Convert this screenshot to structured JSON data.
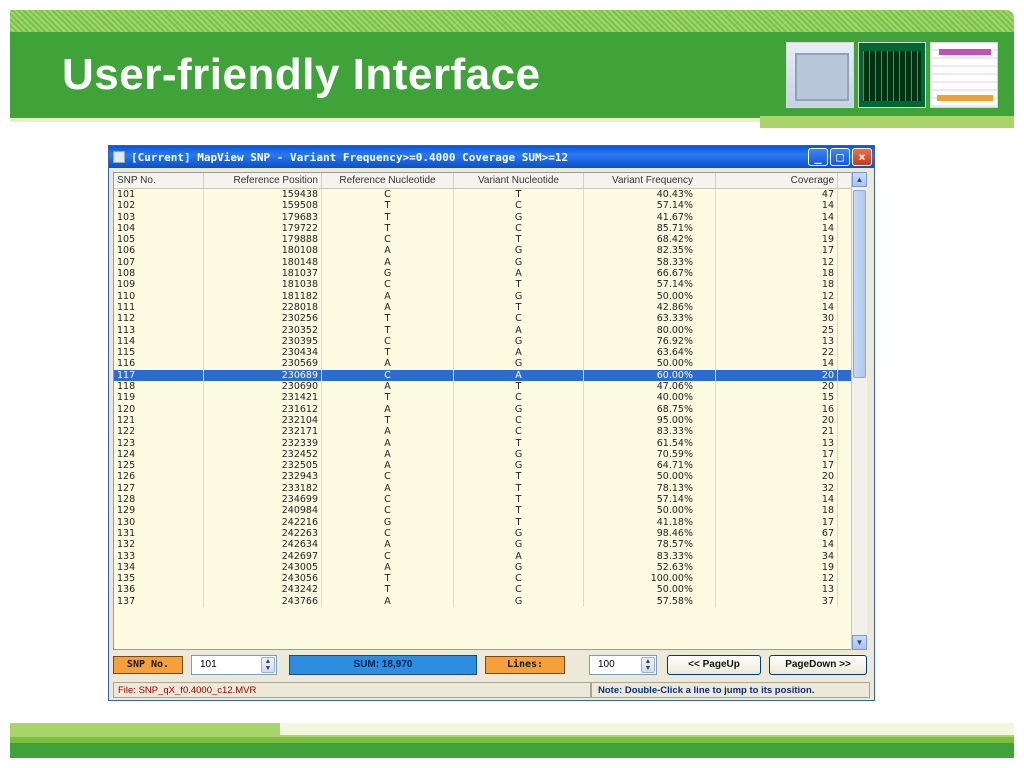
{
  "slide": {
    "title": "User-friendly Interface"
  },
  "window": {
    "title": "[Current] MapView SNP - Variant Frequency>=0.4000 Coverage SUM>=12",
    "controls": {
      "minimize": "_",
      "maximize": "□",
      "close": "×"
    }
  },
  "table": {
    "columns": [
      "SNP No.",
      "Reference Position",
      "Reference Nucleotide",
      "Variant Nucleotide",
      "Variant Frequency",
      "Coverage"
    ],
    "selected_row": "117",
    "rows": [
      [
        "101",
        "159438",
        "C",
        "T",
        "40.43%",
        "47"
      ],
      [
        "102",
        "159508",
        "T",
        "C",
        "57.14%",
        "14"
      ],
      [
        "103",
        "179683",
        "T",
        "G",
        "41.67%",
        "14"
      ],
      [
        "104",
        "179722",
        "T",
        "C",
        "85.71%",
        "14"
      ],
      [
        "105",
        "179888",
        "C",
        "T",
        "68.42%",
        "19"
      ],
      [
        "106",
        "180108",
        "A",
        "G",
        "82.35%",
        "17"
      ],
      [
        "107",
        "180148",
        "A",
        "G",
        "58.33%",
        "12"
      ],
      [
        "108",
        "181037",
        "G",
        "A",
        "66.67%",
        "18"
      ],
      [
        "109",
        "181038",
        "C",
        "T",
        "57.14%",
        "18"
      ],
      [
        "110",
        "181182",
        "A",
        "G",
        "50.00%",
        "12"
      ],
      [
        "111",
        "228018",
        "A",
        "T",
        "42.86%",
        "14"
      ],
      [
        "112",
        "230256",
        "T",
        "C",
        "63.33%",
        "30"
      ],
      [
        "113",
        "230352",
        "T",
        "A",
        "80.00%",
        "25"
      ],
      [
        "114",
        "230395",
        "C",
        "G",
        "76.92%",
        "13"
      ],
      [
        "115",
        "230434",
        "T",
        "A",
        "63.64%",
        "22"
      ],
      [
        "116",
        "230569",
        "A",
        "G",
        "50.00%",
        "14"
      ],
      [
        "117",
        "230689",
        "C",
        "A",
        "60.00%",
        "20"
      ],
      [
        "118",
        "230690",
        "A",
        "T",
        "47.06%",
        "20"
      ],
      [
        "119",
        "231421",
        "T",
        "C",
        "40.00%",
        "15"
      ],
      [
        "120",
        "231612",
        "A",
        "G",
        "68.75%",
        "16"
      ],
      [
        "121",
        "232104",
        "T",
        "C",
        "95.00%",
        "20"
      ],
      [
        "122",
        "232171",
        "A",
        "C",
        "83.33%",
        "21"
      ],
      [
        "123",
        "232339",
        "A",
        "T",
        "61.54%",
        "13"
      ],
      [
        "124",
        "232452",
        "A",
        "G",
        "70.59%",
        "17"
      ],
      [
        "125",
        "232505",
        "A",
        "G",
        "64.71%",
        "17"
      ],
      [
        "126",
        "232943",
        "C",
        "T",
        "50.00%",
        "20"
      ],
      [
        "127",
        "233182",
        "A",
        "T",
        "78.13%",
        "32"
      ],
      [
        "128",
        "234699",
        "C",
        "T",
        "57.14%",
        "14"
      ],
      [
        "129",
        "240984",
        "C",
        "T",
        "50.00%",
        "18"
      ],
      [
        "130",
        "242216",
        "G",
        "T",
        "41.18%",
        "17"
      ],
      [
        "131",
        "242263",
        "C",
        "G",
        "98.46%",
        "67"
      ],
      [
        "132",
        "242634",
        "A",
        "G",
        "78.57%",
        "14"
      ],
      [
        "133",
        "242697",
        "C",
        "A",
        "83.33%",
        "34"
      ],
      [
        "134",
        "243005",
        "A",
        "G",
        "52.63%",
        "19"
      ],
      [
        "135",
        "243056",
        "T",
        "C",
        "100.00%",
        "12"
      ],
      [
        "136",
        "243242",
        "T",
        "C",
        "50.00%",
        "13"
      ],
      [
        "137",
        "243766",
        "A",
        "G",
        "57.58%",
        "37"
      ]
    ]
  },
  "controls": {
    "snp_label": "SNP No.",
    "snp_value": "101",
    "sum_text": "SUM: 18,970",
    "lines_label": "Lines:",
    "lines_value": "100",
    "page_up": "<< PageUp",
    "page_down": "PageDown >>"
  },
  "status": {
    "file": "File: SNP_qX_f0.4000_c12.MVR",
    "note": "Note: Double-Click a line to jump to its position."
  },
  "colors": {
    "brand_green": "#3fa33a",
    "selection": "#2d6bd2",
    "label_orange": "#f5a03a",
    "sum_blue": "#2d8ee0"
  }
}
